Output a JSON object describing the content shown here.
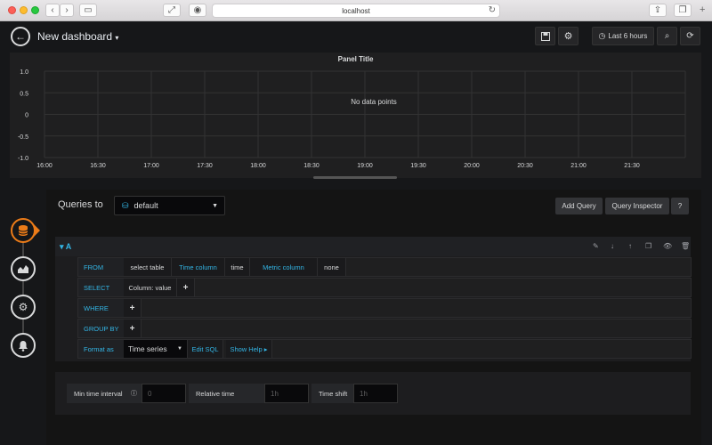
{
  "browser": {
    "url": "localhost"
  },
  "nav": {
    "dashboard_title": "New dashboard",
    "time_range": "Last 6 hours"
  },
  "panel": {
    "title": "Panel Title",
    "no_data": "No data points"
  },
  "chart_data": {
    "type": "line",
    "title": "Panel Title",
    "x": [
      "16:00",
      "16:30",
      "17:00",
      "17:30",
      "18:00",
      "18:30",
      "19:00",
      "19:30",
      "20:00",
      "20:30",
      "21:00",
      "21:30"
    ],
    "y_ticks": [
      "1.0",
      "0.5",
      "0",
      "-0.5",
      "-1.0"
    ],
    "ylim": [
      -1.0,
      1.0
    ],
    "series": [],
    "annotation": "No data points",
    "grid": true
  },
  "editor": {
    "queries_to_label": "Queries to",
    "datasource": "default",
    "add_query": "Add Query",
    "query_inspector": "Query Inspector",
    "help": "?"
  },
  "query": {
    "letter": "A",
    "from_kw": "FROM",
    "from_table": "select table",
    "time_column_label": "Time column",
    "time_column_value": "time",
    "metric_column_label": "Metric column",
    "metric_column_value": "none",
    "select_kw": "SELECT",
    "select_value": "Column: value",
    "where_kw": "WHERE",
    "group_by_kw": "GROUP BY",
    "format_as_kw": "Format as",
    "format_as_value": "Time series",
    "edit_sql": "Edit SQL",
    "show_help": "Show Help ▸"
  },
  "options": {
    "min_interval_label": "Min time interval",
    "min_interval_placeholder": "0",
    "relative_time_label": "Relative time",
    "relative_time_placeholder": "1h",
    "time_shift_label": "Time shift",
    "time_shift_placeholder": "1h"
  },
  "colors": {
    "accent_blue": "#33b5e5",
    "active_orange": "#eb7b18",
    "background": "#161719"
  }
}
